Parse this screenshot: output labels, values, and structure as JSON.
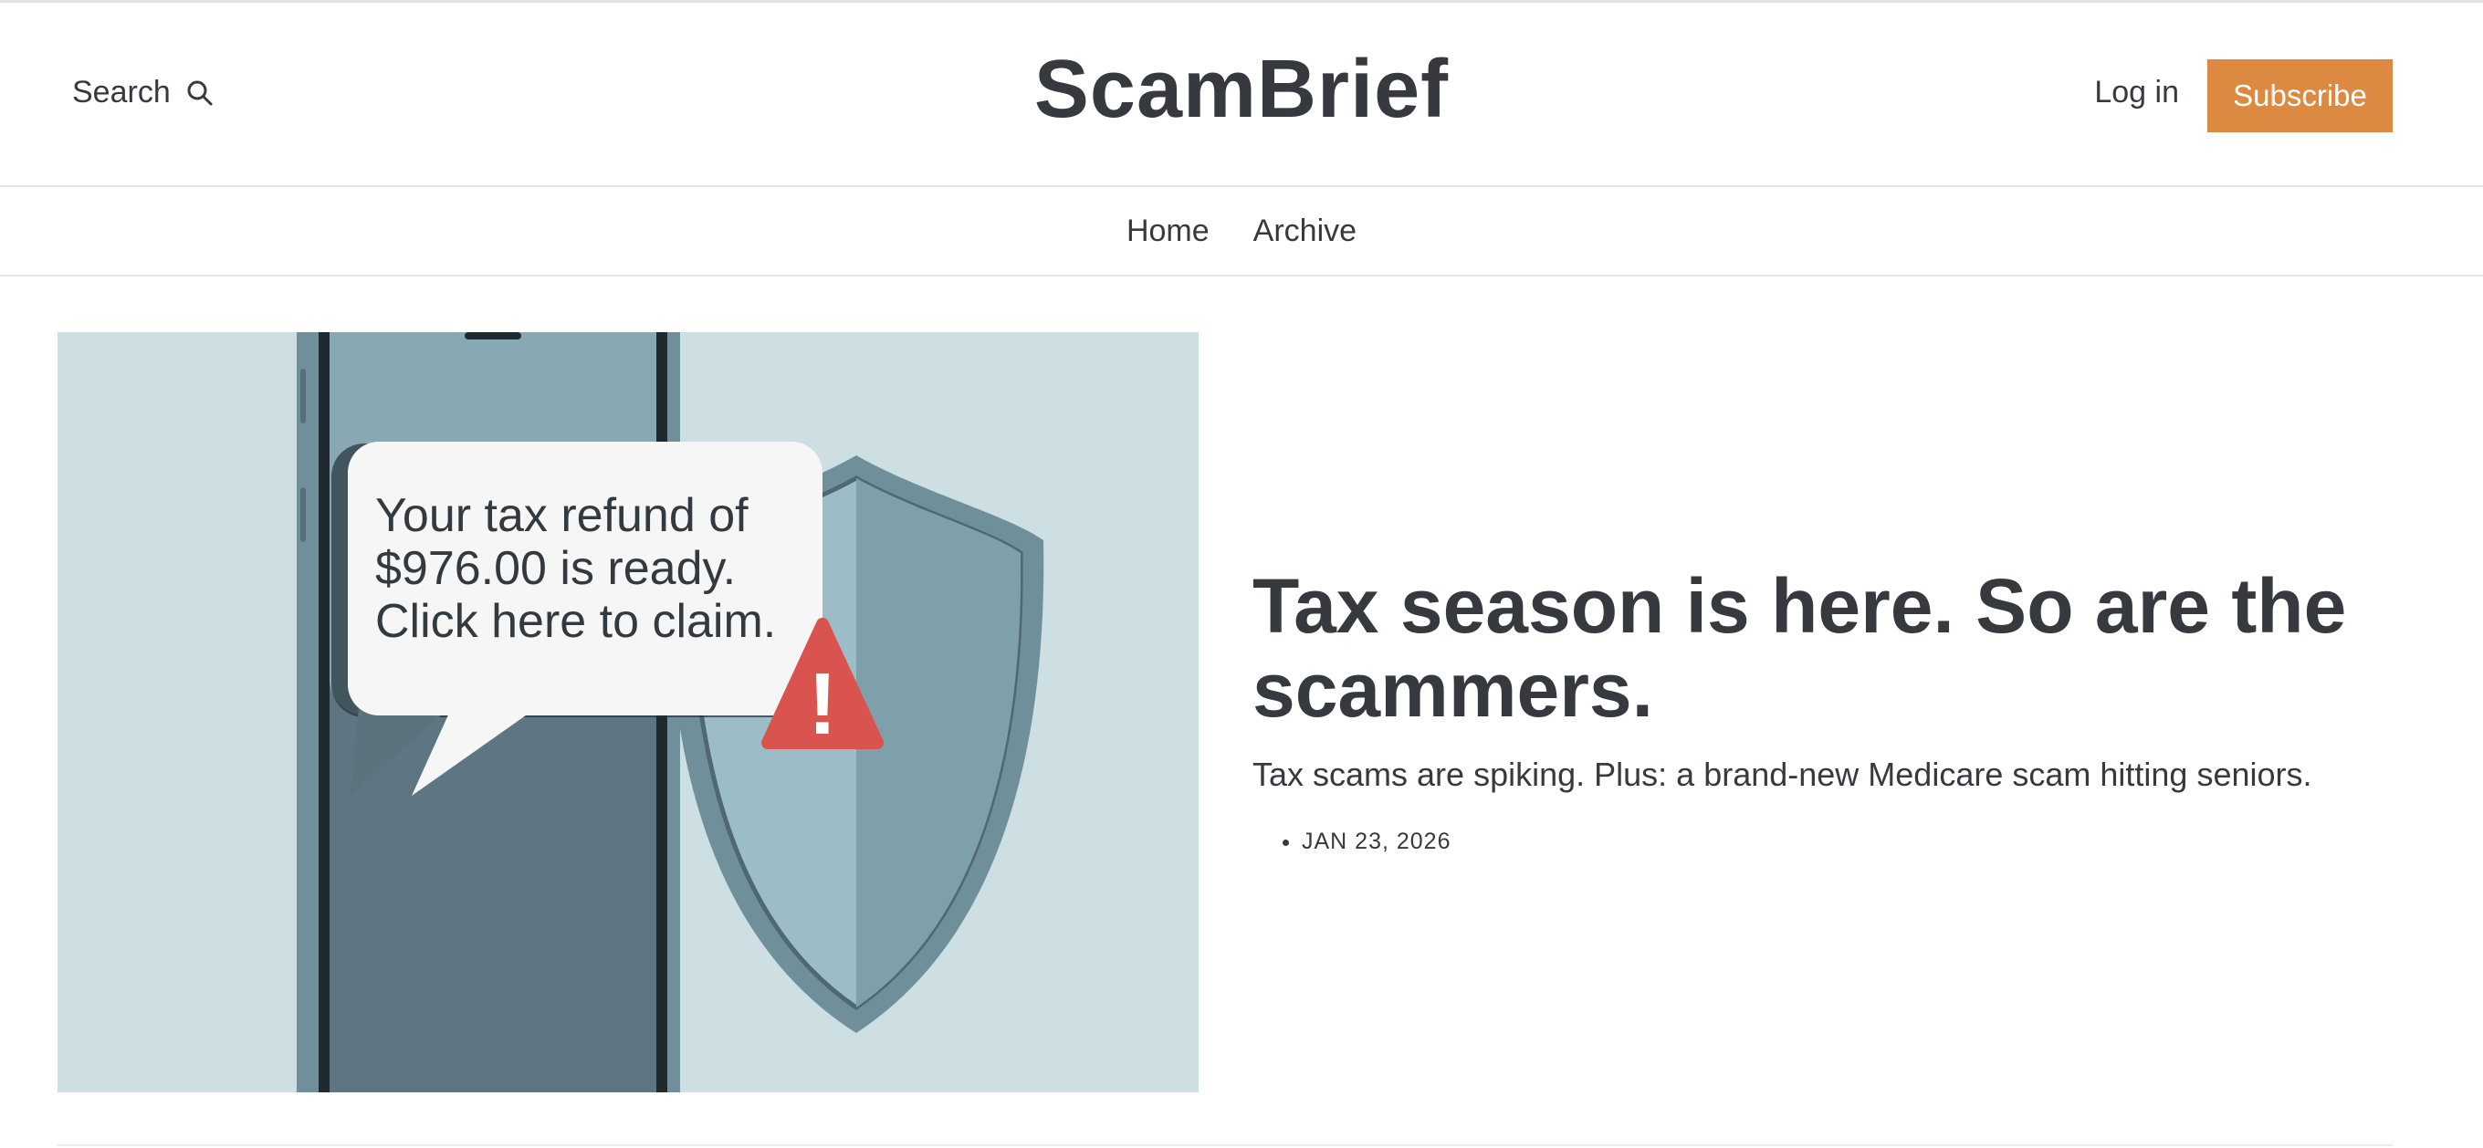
{
  "header": {
    "search_label": "Search",
    "logo": "ScamBrief",
    "login_label": "Log in",
    "subscribe_label": "Subscribe"
  },
  "nav": {
    "items": [
      "Home",
      "Archive"
    ]
  },
  "hero": {
    "image": {
      "bubble_lines": [
        "Your tax refund of",
        "$976.00 is ready.",
        "Click here to claim."
      ],
      "warning_mark": "!"
    },
    "title": "Tax season is here. So are the scammers.",
    "subtitle": "Tax scams are spiking. Plus: a brand-new Medicare scam hitting seniors.",
    "date": "JAN 23, 2026"
  },
  "colors": {
    "accent": "#dc8a42",
    "text": "#363a3f",
    "image_background": "#cddfe2",
    "warning": "#d9534f"
  }
}
